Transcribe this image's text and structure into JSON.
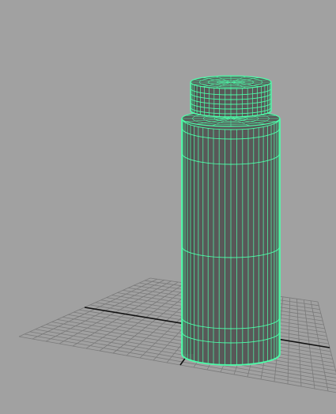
{
  "viewport": {
    "background_color": "#a1a1a1",
    "grid_color": "#7a7a7a",
    "axis_color": "#111111",
    "wireframe_color": "#4dffaa",
    "object_fill_color": "#585858",
    "object_shade_color": "#4a4a4a"
  },
  "scene": {
    "object": "cylinder-bottle",
    "display_mode": "wireframe-on-shaded",
    "selected": true,
    "grid_visible": true
  }
}
